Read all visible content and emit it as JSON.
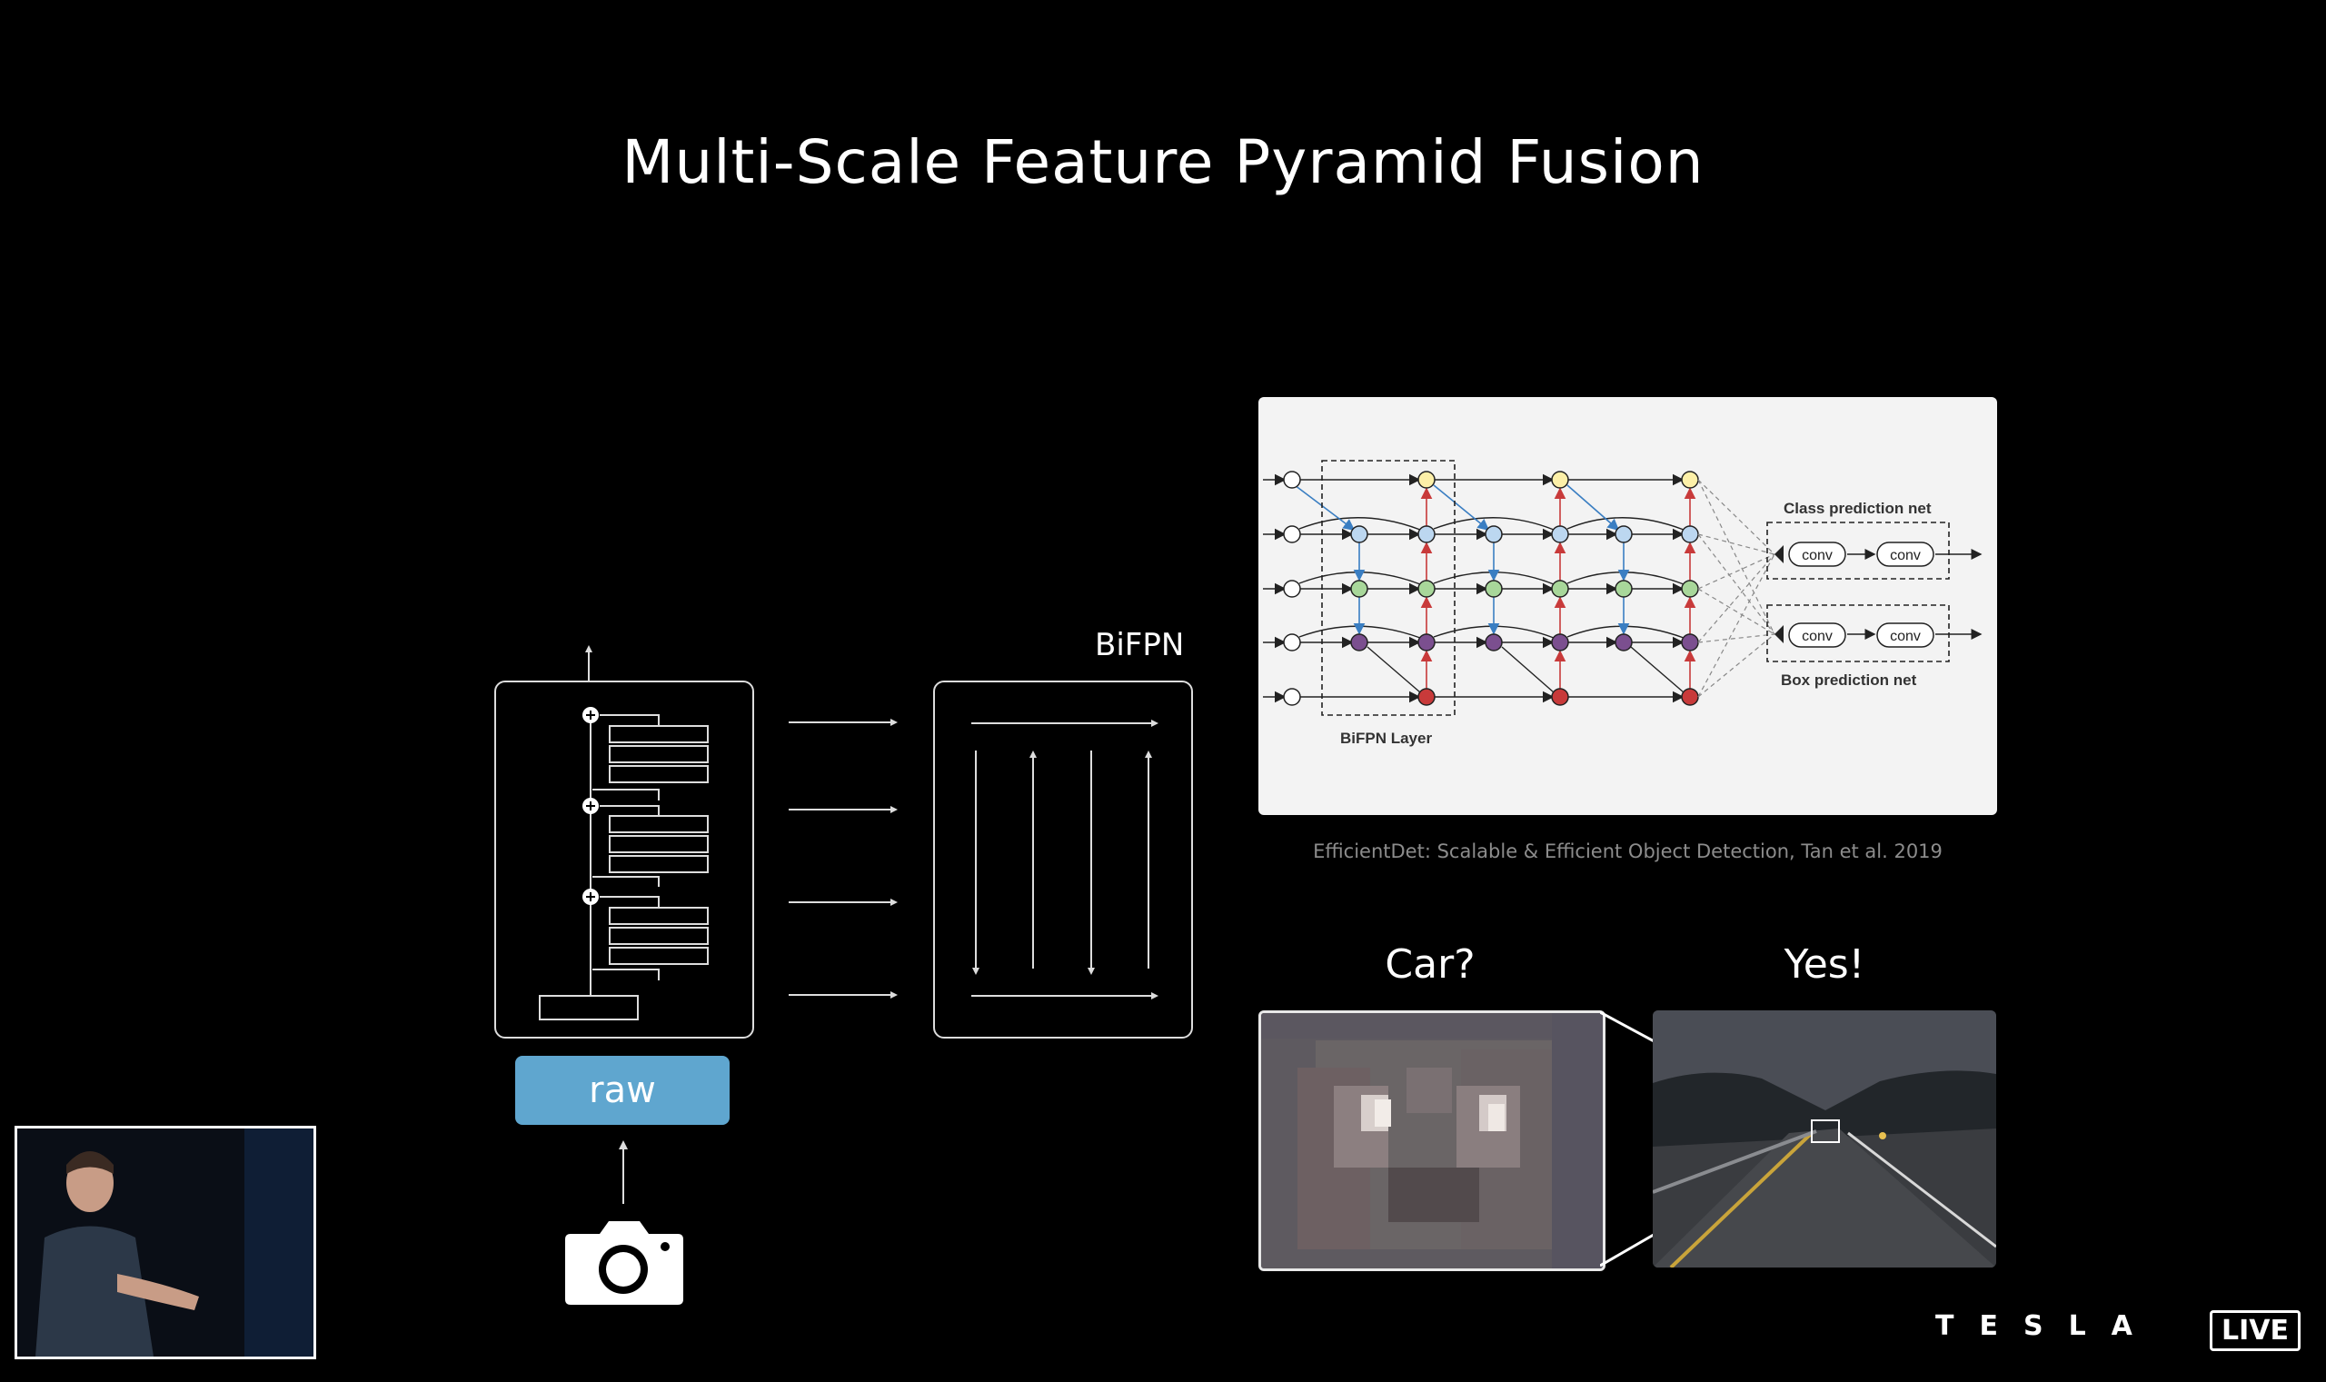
{
  "slide": {
    "title": "Multi-Scale Feature Pyramid Fusion",
    "bifpn_label": "BiFPN",
    "raw_label": "raw",
    "citation": "EfficientDet: Scalable & Efficient Object Detection, Tan et al. 2019",
    "car_question": "Car?",
    "yes_answer": "Yes!"
  },
  "figure": {
    "class_prediction_net": "Class prediction net",
    "box_prediction_net": "Box prediction net",
    "bifpn_layer": "BiFPN Layer",
    "conv": "conv"
  },
  "branding": {
    "logo": "TESLA",
    "live": "LIVE"
  },
  "colors": {
    "raw_button": "#5fa6cf",
    "node_yellow": "#fdf0a8",
    "node_blue": "#bcd7f0",
    "node_green": "#a8d79a",
    "node_purple": "#7b4f8f",
    "node_red": "#c83a3a"
  }
}
